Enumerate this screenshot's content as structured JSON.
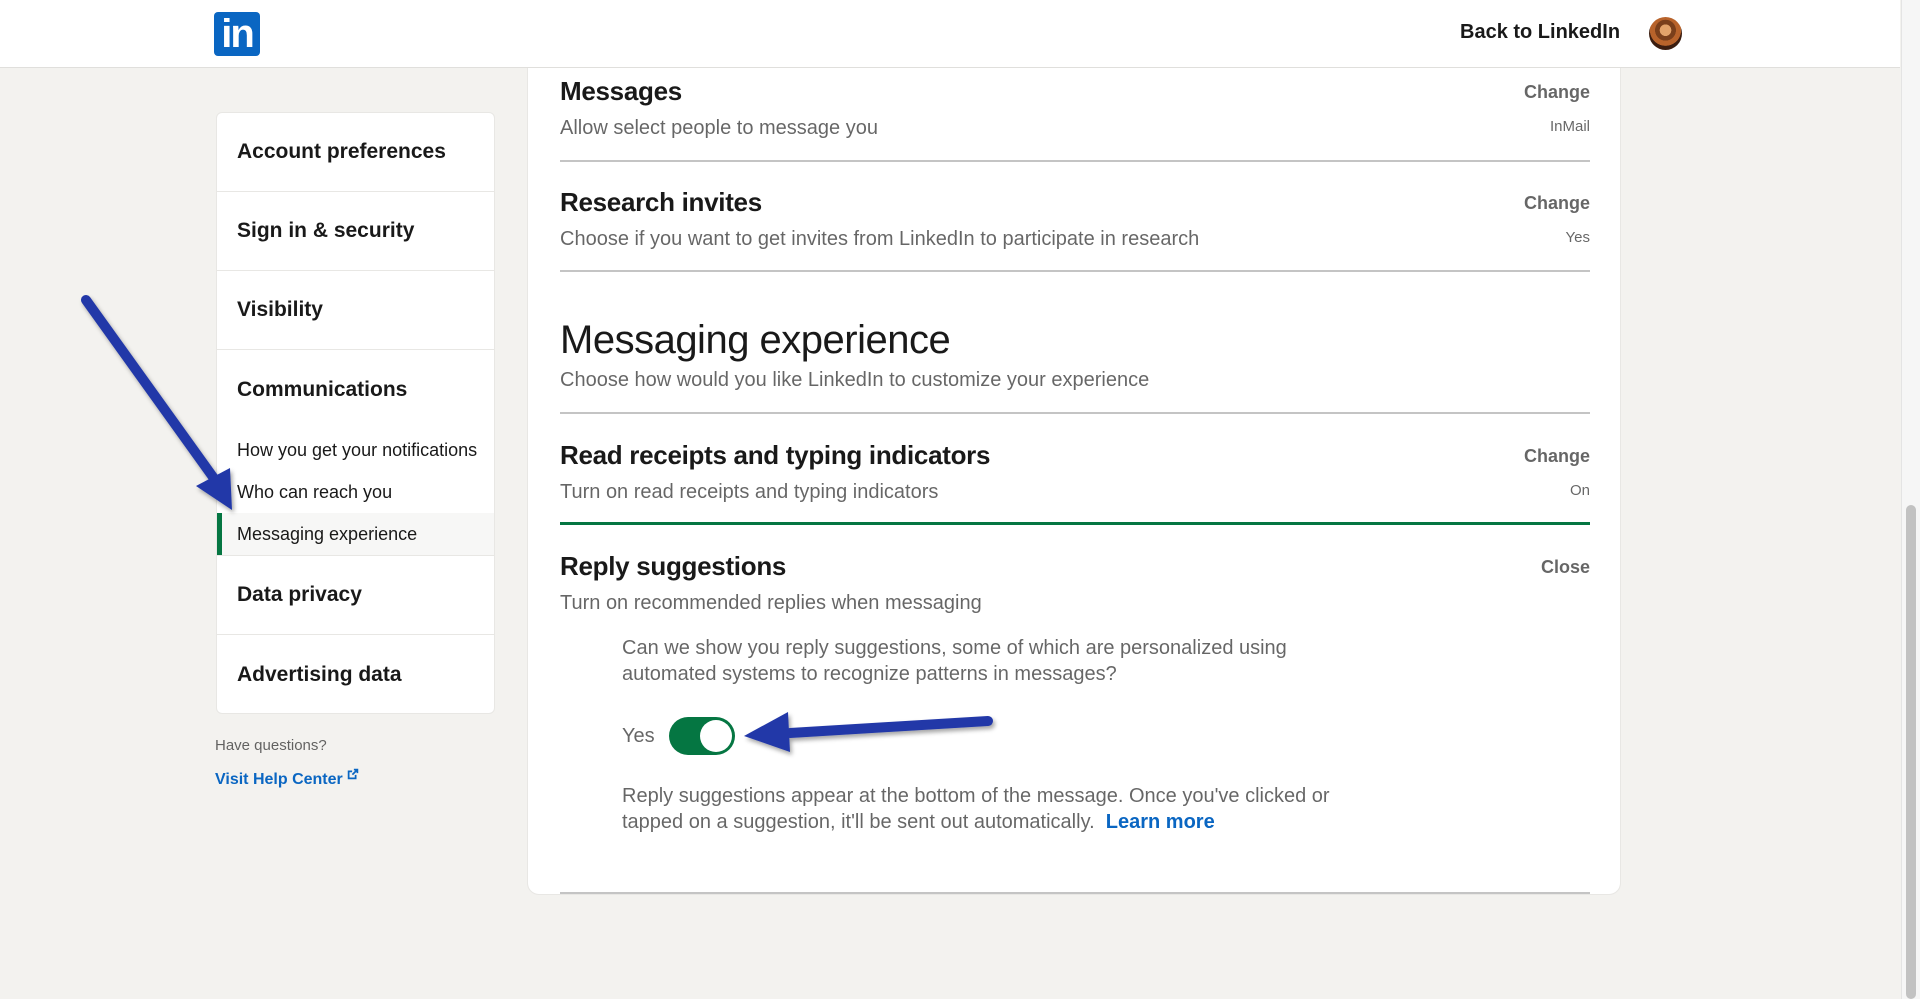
{
  "header": {
    "logo_text": "in",
    "back_link": "Back to LinkedIn"
  },
  "sidebar": {
    "items": [
      {
        "label": "Account preferences"
      },
      {
        "label": "Sign in & security"
      },
      {
        "label": "Visibility"
      },
      {
        "label": "Communications",
        "subitems": [
          {
            "label": "How you get your notifications"
          },
          {
            "label": "Who can reach you"
          },
          {
            "label": "Messaging experience",
            "active": true
          }
        ]
      },
      {
        "label": "Data privacy"
      },
      {
        "label": "Advertising data"
      }
    ],
    "help_question": "Have questions?",
    "help_link": "Visit Help Center"
  },
  "main": {
    "rows": [
      {
        "title": "Messages",
        "description": "Allow select people to message you",
        "action": "Change",
        "value": "InMail"
      },
      {
        "title": "Research invites",
        "description": "Choose if you want to get invites from LinkedIn to participate in research",
        "action": "Change",
        "value": "Yes"
      }
    ],
    "section": {
      "title": "Messaging experience",
      "description": "Choose how would you like LinkedIn to customize your experience"
    },
    "read_receipts": {
      "title": "Read receipts and typing indicators",
      "description": "Turn on read receipts and typing indicators",
      "action": "Change",
      "value": "On"
    },
    "reply_suggestions": {
      "title": "Reply suggestions",
      "description": "Turn on recommended replies when messaging",
      "action": "Close",
      "question": "Can we show you reply suggestions, some of which are personalized using automated systems to recognize patterns in messages?",
      "toggle_label": "Yes",
      "toggle_on": true,
      "info": "Reply suggestions appear at the bottom of the message. Once you've clicked or tapped on a suggestion, it'll be sent out automatically.",
      "learn_more": "Learn more"
    }
  },
  "colors": {
    "brand": "#0a66c2",
    "active_green": "#057642",
    "annotation_arrow": "#2238a8",
    "background": "#f3f2ef"
  }
}
